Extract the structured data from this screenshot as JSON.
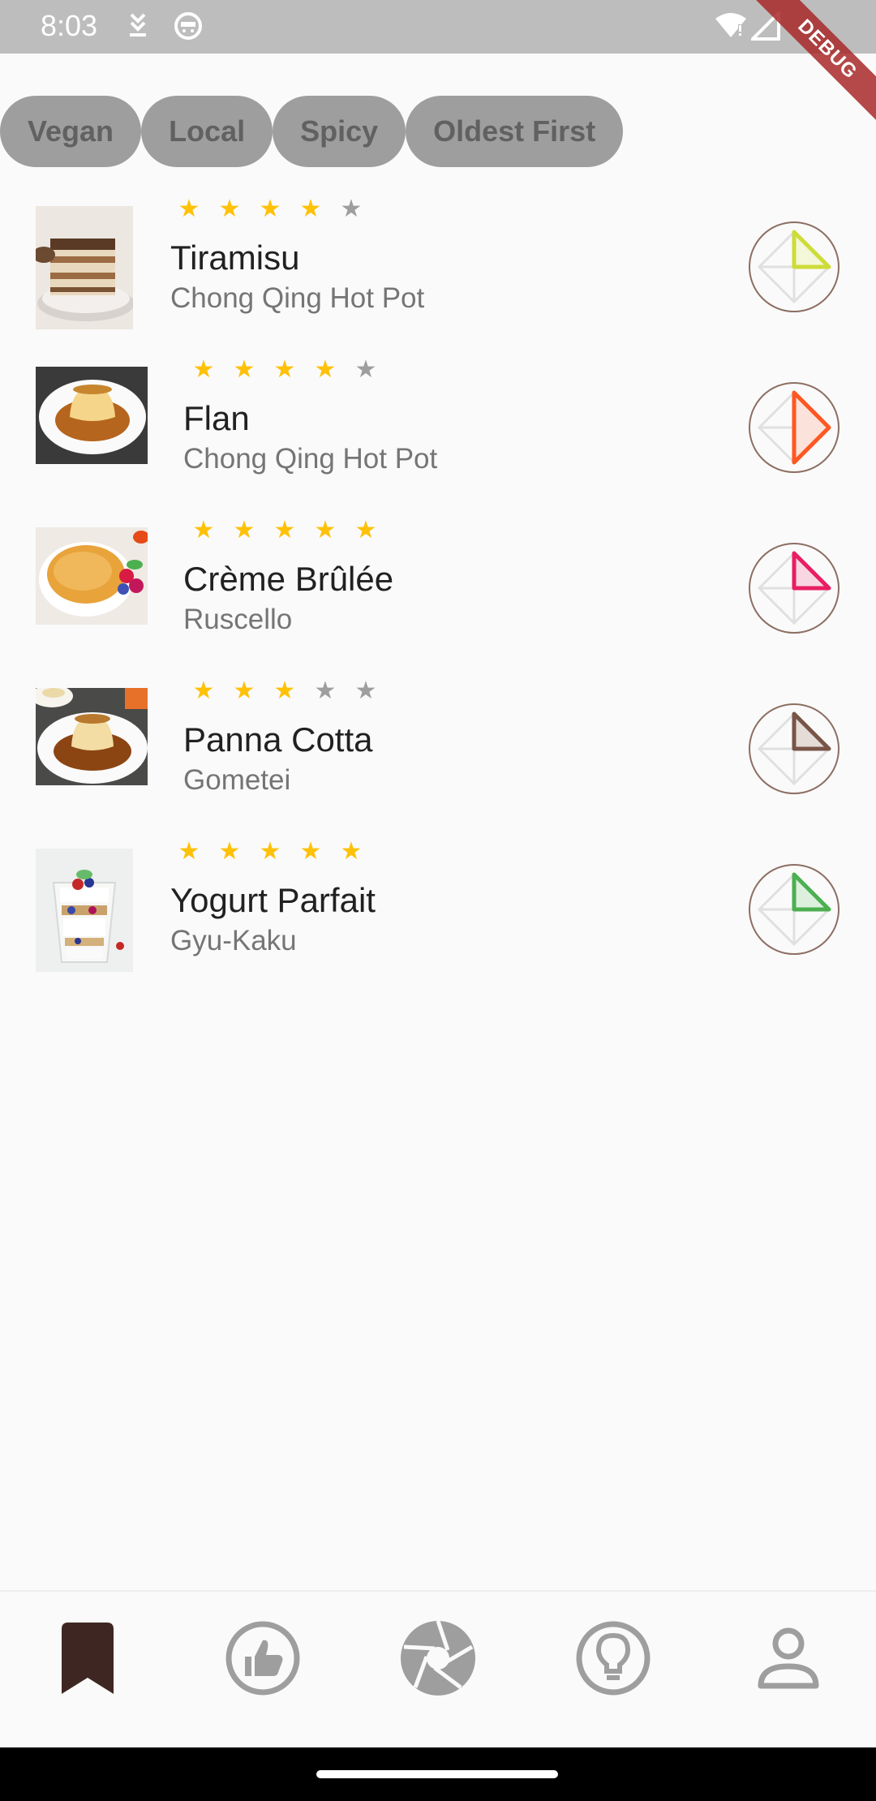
{
  "status_bar": {
    "time": "8:03",
    "icons": [
      "download-icon",
      "cat-face-icon",
      "wifi-icon",
      "signal-icon"
    ]
  },
  "debug_banner": "DEBUG",
  "filters": [
    {
      "label": "Vegan"
    },
    {
      "label": "Local"
    },
    {
      "label": "Spicy"
    },
    {
      "label": "Oldest First"
    }
  ],
  "dishes": [
    {
      "name": "Tiramisu",
      "restaurant": "Chong Qing Hot Pot",
      "rating": 4,
      "rating_max": 5,
      "accent": "#CDDC39"
    },
    {
      "name": "Flan",
      "restaurant": "Chong Qing Hot Pot",
      "rating": 4,
      "rating_max": 5,
      "accent": "#FF5722"
    },
    {
      "name": "Crème Brûlée",
      "restaurant": "Ruscello",
      "rating": 5,
      "rating_max": 5,
      "accent": "#E91E63"
    },
    {
      "name": "Panna Cotta",
      "restaurant": "Gometei",
      "rating": 3,
      "rating_max": 5,
      "accent": "#795548"
    },
    {
      "name": "Yogurt Parfait",
      "restaurant": "Gyu-Kaku",
      "rating": 5,
      "rating_max": 5,
      "accent": "#4CAF50"
    }
  ],
  "bottom_nav": [
    {
      "icon": "bookmark-icon",
      "active": true
    },
    {
      "icon": "thumb-up-icon",
      "active": false
    },
    {
      "icon": "camera-aperture-icon",
      "active": false
    },
    {
      "icon": "lightbulb-icon",
      "active": false
    },
    {
      "icon": "person-icon",
      "active": false
    }
  ],
  "colors": {
    "star_filled": "#FFC107",
    "star_empty": "#9E9E9E",
    "nav_active": "#3E2723",
    "nav_inactive": "#9E9E9E"
  }
}
